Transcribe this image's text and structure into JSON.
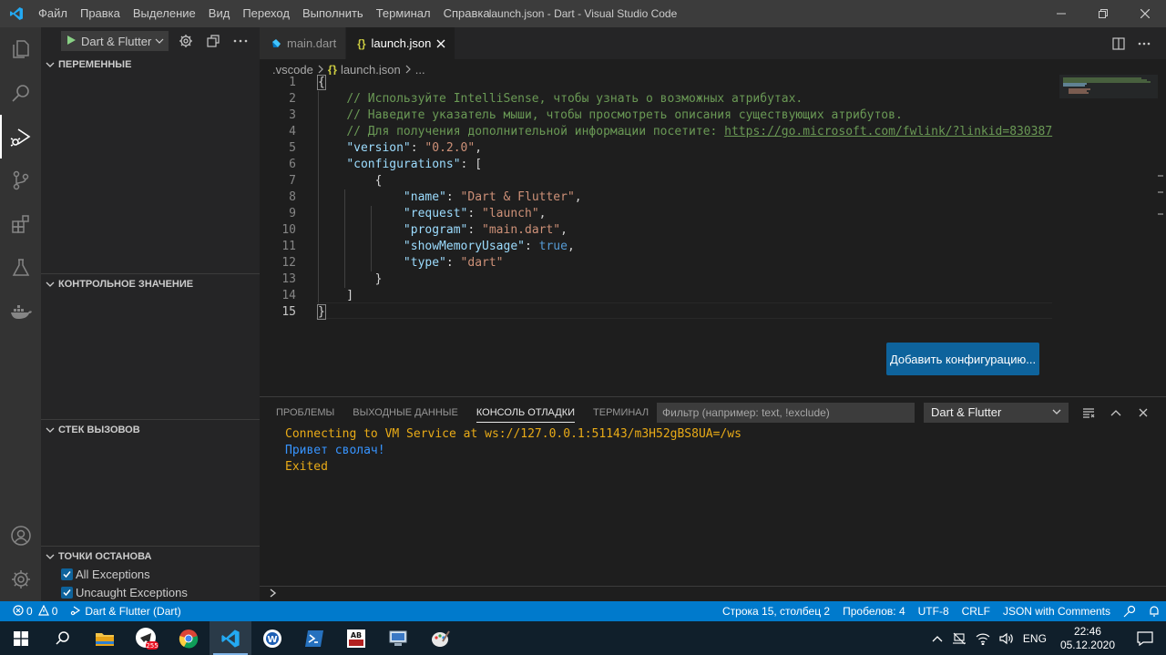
{
  "window": {
    "title": "launch.json - Dart - Visual Studio Code",
    "menu": [
      "Файл",
      "Правка",
      "Выделение",
      "Вид",
      "Переход",
      "Выполнить",
      "Терминал",
      "Справка"
    ]
  },
  "debug_toolbar": {
    "config_label": "Dart & Flutter"
  },
  "sidebar": {
    "sections": {
      "variables": "ПЕРЕМЕННЫЕ",
      "watch": "КОНТРОЛЬНОЕ ЗНАЧЕНИЕ",
      "callstack": "СТЕК ВЫЗОВОВ",
      "breakpoints": "ТОЧКИ ОСТАНОВА"
    },
    "breakpoints": [
      {
        "label": "All Exceptions",
        "checked": true
      },
      {
        "label": "Uncaught Exceptions",
        "checked": true
      }
    ]
  },
  "tabs": [
    {
      "label": "main.dart",
      "active": false
    },
    {
      "label": "launch.json",
      "active": true
    }
  ],
  "breadcrumb": {
    "folder": ".vscode",
    "file": "launch.json",
    "more": "..."
  },
  "editor": {
    "line_numbers": [
      "1",
      "2",
      "3",
      "4",
      "5",
      "6",
      "7",
      "8",
      "9",
      "10",
      "11",
      "12",
      "13",
      "14",
      "15"
    ],
    "comment1": "// Используйте IntelliSense, чтобы узнать о возможных атрибутах.",
    "comment2": "// Наведите указатель мыши, чтобы просмотреть описания существующих атрибутов.",
    "comment3_prefix": "// Для получения дополнительной информации посетите: ",
    "comment3_link": "https://go.microsoft.com/fwlink/?linkid=830387",
    "version_key": "\"version\"",
    "version_val": "\"0.2.0\"",
    "configs_key": "\"configurations\"",
    "name_key": "\"name\"",
    "name_val": "\"Dart & Flutter\"",
    "request_key": "\"request\"",
    "request_val": "\"launch\"",
    "program_key": "\"program\"",
    "program_val": "\"main.dart\"",
    "mem_key": "\"showMemoryUsage\"",
    "mem_val": "true",
    "type_key": "\"type\"",
    "type_val": "\"dart\"",
    "add_config_button": "Добавить конфигурацию..."
  },
  "panel": {
    "tabs": [
      "ПРОБЛЕМЫ",
      "ВЫХОДНЫЕ ДАННЫЕ",
      "КОНСОЛЬ ОТЛАДКИ",
      "ТЕРМИНАЛ"
    ],
    "active_tab": "КОНСОЛЬ ОТЛАДКИ",
    "filter_placeholder": "Фильтр (например: text, !exclude)",
    "session_select": "Dart & Flutter",
    "console": [
      {
        "text": "Connecting to VM Service at ws://127.0.0.1:51143/m3H52gBS8UA=/ws",
        "color": "#e9ab17"
      },
      {
        "text": "Привет сволач!",
        "color": "#3794ff"
      },
      {
        "text": "Exited",
        "color": "#e9ab17"
      }
    ],
    "repl_prompt": ">"
  },
  "statusbar": {
    "errors": "0",
    "warnings": "0",
    "debug_session": "Dart & Flutter (Dart)",
    "position": "Строка 15, столбец 2",
    "indent": "Пробелов: 4",
    "encoding": "UTF-8",
    "eol": "CRLF",
    "language": "JSON with Comments"
  },
  "taskbar": {
    "badge": "255",
    "lang": "ENG",
    "time": "22:46",
    "date": "05.12.2020"
  },
  "colors": {
    "accent": "#007acc",
    "button": "#0e639c",
    "console_yellow": "#e9ab17",
    "console_blue": "#3794ff"
  }
}
